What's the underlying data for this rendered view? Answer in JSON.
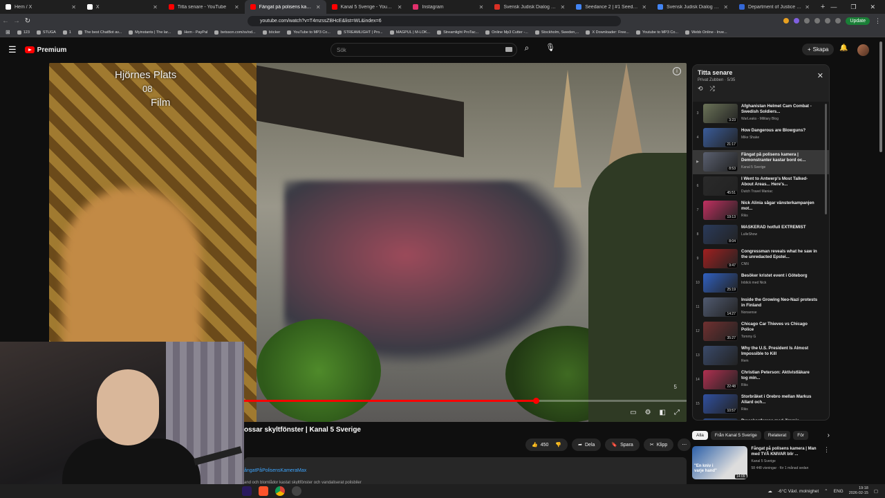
{
  "browser": {
    "tabs": [
      {
        "label": "Hem / X",
        "color": "#ffffff"
      },
      {
        "label": "X",
        "color": "#ffffff"
      },
      {
        "label": "Titta senare - YouTube",
        "color": "#ff0000"
      },
      {
        "label": "Fångat på polisens kamera",
        "color": "#ff0000",
        "active": true
      },
      {
        "label": "Kanal 5 Sverige - YouTube",
        "color": "#ff0000"
      },
      {
        "label": "Instagram",
        "color": "#e1306c"
      },
      {
        "label": "Svensk Judisk Dialog kampanjar fö",
        "color": "#d93025"
      },
      {
        "label": "Seedance 2 | #1 Seedance 2 AI Vi",
        "color": "#4285f4"
      },
      {
        "label": "Svensk Judisk Dialog - Google Sea",
        "color": "#4285f4"
      },
      {
        "label": "Department of Justice | Epstein Lib",
        "color": "#3367d6"
      }
    ],
    "url": "youtube.com/watch?v=T4mzssZBHcE&list=WL&index=6",
    "update_label": "Update",
    "bookmarks": [
      "123",
      "STUGA",
      "1",
      "The best ChatBot av...",
      "Myinstants | The lar...",
      "Hem - PayPal",
      "betsson.com/sv/od...",
      "böcker",
      "YouTube to MP3 Co...",
      "STREAMLIGHT | Pro...",
      "MAGPUL | M-LOK...",
      "Streamlight ProTac...",
      "Online Mp3 Cutter -...",
      "Stockholm, Sweden,...",
      "X Downloader: Free...",
      "Youtube to MP3 Co...",
      "Webb Online - Inve..."
    ]
  },
  "yt": {
    "logo": "Premium",
    "search_placeholder": "Sök",
    "create_label": "Skapa"
  },
  "video": {
    "overlay_lines": [
      "Hjörnes Plats",
      "08",
      "Film"
    ],
    "playlist_position": "5",
    "progress": 0.66,
    "title": "ossar skyltfönster | Kanal 5 Sverige",
    "likes": "450",
    "share": "Dela",
    "save": "Spara",
    "clip": "Klipp",
    "hashtag": "ångatPåPolisensKameraMax",
    "desc_snippet": "and och blomlådor kastat skyltfönster och vandaliserat polisbiler"
  },
  "playlist": {
    "title": "Titta senare",
    "subtitle": "Privat  Zubben · 5/35",
    "items": [
      {
        "idx": "3",
        "title": "Afghanistan Helmet Cam Combat - Swedish Soldiers...",
        "channel": "WarLeaks - Military Blog",
        "dur": "3:23",
        "color": "#6b7358"
      },
      {
        "idx": "4",
        "title": "How Dangerous are Blowguns?",
        "channel": "Mike Shake",
        "dur": "21:17",
        "color": "#3a5c9a"
      },
      {
        "idx": "▶",
        "title": "Fångat på polisens kamera | Demonstranter kastar bord oc...",
        "channel": "Kanal 5 Sverige",
        "dur": "8:53",
        "color": "#5a6070",
        "current": true
      },
      {
        "idx": "6",
        "title": "I Went to Antwerp's Most Talked-About Areas... Here's...",
        "channel": "Dutch Travel Maniac",
        "dur": "45:51",
        "color": "#2a2a2a"
      },
      {
        "idx": "7",
        "title": "Nick Alinia sågar vänsterkampanjen mot...",
        "channel": "Riks",
        "dur": "19:13",
        "color": "#c03060"
      },
      {
        "idx": "8",
        "title": "MASKERAD hotfull EXTREMIST",
        "channel": "LulleShow",
        "dur": "8:04",
        "color": "#2a3a5a"
      },
      {
        "idx": "9",
        "title": "Congressman reveals what he saw in the unredacted Epstei...",
        "channel": "CNN",
        "dur": "9:47",
        "color": "#a02020"
      },
      {
        "idx": "10",
        "title": "Besöker kristet event i Göteborg",
        "channel": "Inblick med Nick",
        "dur": "25:19",
        "color": "#3060c0"
      },
      {
        "idx": "11",
        "title": "Inside the Growing Neo-Nazi protests in Finland",
        "channel": "Nonsense",
        "dur": "14:27",
        "color": "#505a70"
      },
      {
        "idx": "12",
        "title": "Chicago Car Thieves vs Chicago Police",
        "channel": "Tommy G",
        "dur": "35:27",
        "color": "#703030"
      },
      {
        "idx": "13",
        "title": "Why the U.S. President Is Almost Impossible to Kill",
        "channel": "Rem",
        "dur": "",
        "color": "#3a4a6a"
      },
      {
        "idx": "14",
        "title": "Christian Peterson: Aktivistläkare tog min...",
        "channel": "Riks",
        "dur": "22:48",
        "color": "#b03050"
      },
      {
        "idx": "15",
        "title": "Storbråket i Örebro mellan Markus Allard och...",
        "channel": "Riks",
        "dur": "10:57",
        "color": "#3050a0"
      },
      {
        "idx": "",
        "title": "Presskonferens med Jimmie",
        "channel": "",
        "dur": "",
        "color": "#2a4a8a"
      }
    ]
  },
  "chips": [
    "Alla",
    "Från Kanal 5 Sverige",
    "Relaterat",
    "För"
  ],
  "recommendation": {
    "title": "Fångat på polisens kamera | Man med TVÅ KNIVAR blir ...",
    "channel": "Kanal 5 Sverige",
    "meta": "58 448 visningar · för 1 månad sedan",
    "dur": "14:09",
    "thumb_text": "\"En kniv i varje hand\""
  },
  "taskbar": {
    "weather": "-6°C  Växl. molnighet",
    "lang": "ENG",
    "time": "19:18",
    "date": "2026-02-15"
  }
}
